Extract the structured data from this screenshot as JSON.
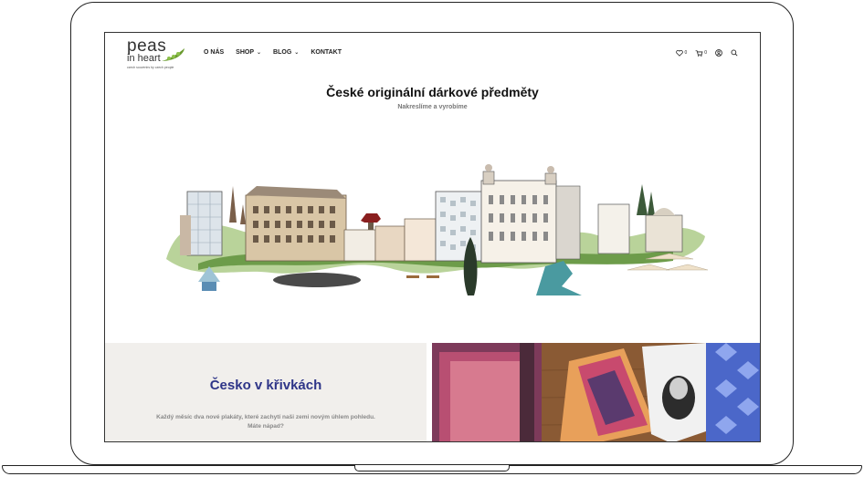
{
  "brand": {
    "name_line1": "peas",
    "name_line2": "in heart",
    "tagline": "czech souvenirs by czech people",
    "accent_color": "#6a9b2f"
  },
  "nav": {
    "items": [
      {
        "label": "O NÁS",
        "has_dropdown": false
      },
      {
        "label": "SHOP",
        "has_dropdown": true
      },
      {
        "label": "BLOG",
        "has_dropdown": true
      },
      {
        "label": "KONTAKT",
        "has_dropdown": false
      }
    ]
  },
  "header_icons": {
    "wishlist": {
      "icon": "heart-icon",
      "count": "0"
    },
    "cart": {
      "icon": "cart-icon",
      "count": "0"
    },
    "account": {
      "icon": "user-icon"
    },
    "search": {
      "icon": "search-icon"
    }
  },
  "hero": {
    "title": "České originální dárkové předměty",
    "subtitle": "Nakreslíme a vyrobíme"
  },
  "promo": {
    "title": "Česko v křivkách",
    "text": "Každý měsíc dva nové plakáty, které zachytí naši zemi novým úhlem pohledu. Máte nápad?",
    "title_color": "#2e3588",
    "bg_color": "#f1efec"
  }
}
